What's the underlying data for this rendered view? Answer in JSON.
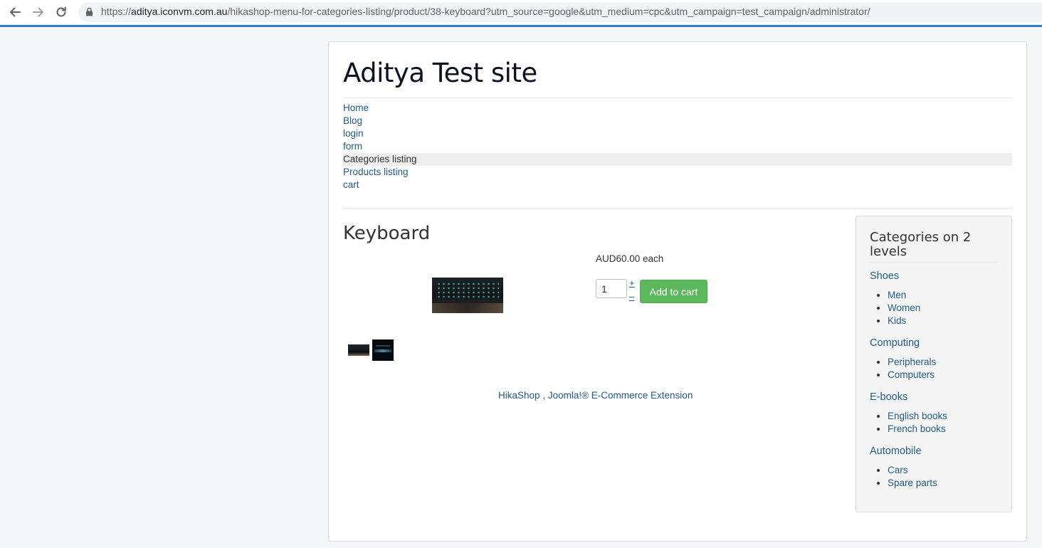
{
  "browser": {
    "url_host": "aditya.iconvm.com.au",
    "url_scheme": "https://",
    "url_path": "/hikashop-menu-for-categories-listing/product/38-keyboard?utm_source=google&utm_medium=cpc&utm_campaign=test_campaign/administrator/",
    "icons": [
      "back-arrow-icon",
      "forward-arrow-icon",
      "reload-icon",
      "lock-icon"
    ]
  },
  "site": {
    "title": "Aditya Test site"
  },
  "menu": {
    "items": [
      {
        "label": "Home",
        "active": false
      },
      {
        "label": "Blog",
        "active": false
      },
      {
        "label": "login",
        "active": false
      },
      {
        "label": "form",
        "active": false
      },
      {
        "label": "Categories listing",
        "active": true
      },
      {
        "label": "Products listing",
        "active": false
      },
      {
        "label": "cart",
        "active": false
      }
    ]
  },
  "product": {
    "title": "Keyboard",
    "price": "AUD60.00 each",
    "quantity": "1",
    "qty_plus": "+",
    "qty_minus": "–",
    "add_to_cart": "Add to cart"
  },
  "footer": {
    "hikashop": "HikaShop",
    "separator": " , ",
    "joomla": "Joomla!® E-Commerce Extension"
  },
  "sidebar": {
    "title": "Categories on 2 levels",
    "categories": [
      {
        "name": "Shoes",
        "children": [
          "Men",
          "Women",
          "Kids"
        ]
      },
      {
        "name": "Computing",
        "children": [
          "Peripherals",
          "Computers"
        ]
      },
      {
        "name": "E-books",
        "children": [
          "English books",
          "French books"
        ]
      },
      {
        "name": "Automobile",
        "children": [
          "Cars",
          "Spare parts"
        ]
      }
    ]
  },
  "colors": {
    "link": "#1f5b8a",
    "button_green": "#5cb85c",
    "accent_bar": "#2f7fc1"
  }
}
